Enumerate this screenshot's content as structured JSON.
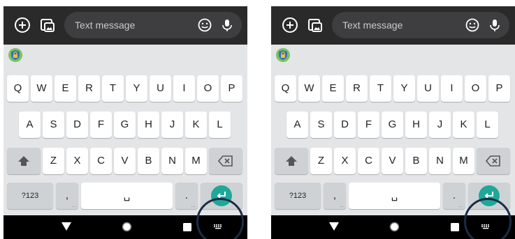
{
  "composer": {
    "placeholder": "Text message",
    "icons": [
      "add-icon",
      "gallery-icon",
      "emoji-icon",
      "mic-icon"
    ]
  },
  "keyboard": {
    "row1": [
      "Q",
      "W",
      "E",
      "R",
      "T",
      "Y",
      "U",
      "I",
      "O",
      "P"
    ],
    "row2": [
      "A",
      "S",
      "D",
      "F",
      "G",
      "H",
      "J",
      "K",
      "L"
    ],
    "row3": [
      "Z",
      "X",
      "C",
      "V",
      "B",
      "N",
      "M"
    ],
    "symbols_label": "?123",
    "comma": ",",
    "period": ".",
    "space_label": "␣",
    "shift_icon": "shift-icon",
    "backspace_icon": "backspace-icon",
    "enter_icon": "enter-icon",
    "suggestion_icon": "shield-lock-icon"
  },
  "navbar": {
    "icons": [
      "back-icon",
      "home-icon",
      "recents-icon",
      "keyboard-switcher-icon"
    ]
  },
  "colors": {
    "accent": "#1fa89a",
    "highlight_ring": "#1b2c45",
    "keyboard_bg": "#e4e5e7",
    "composer_bg": "#2a2a2a"
  }
}
